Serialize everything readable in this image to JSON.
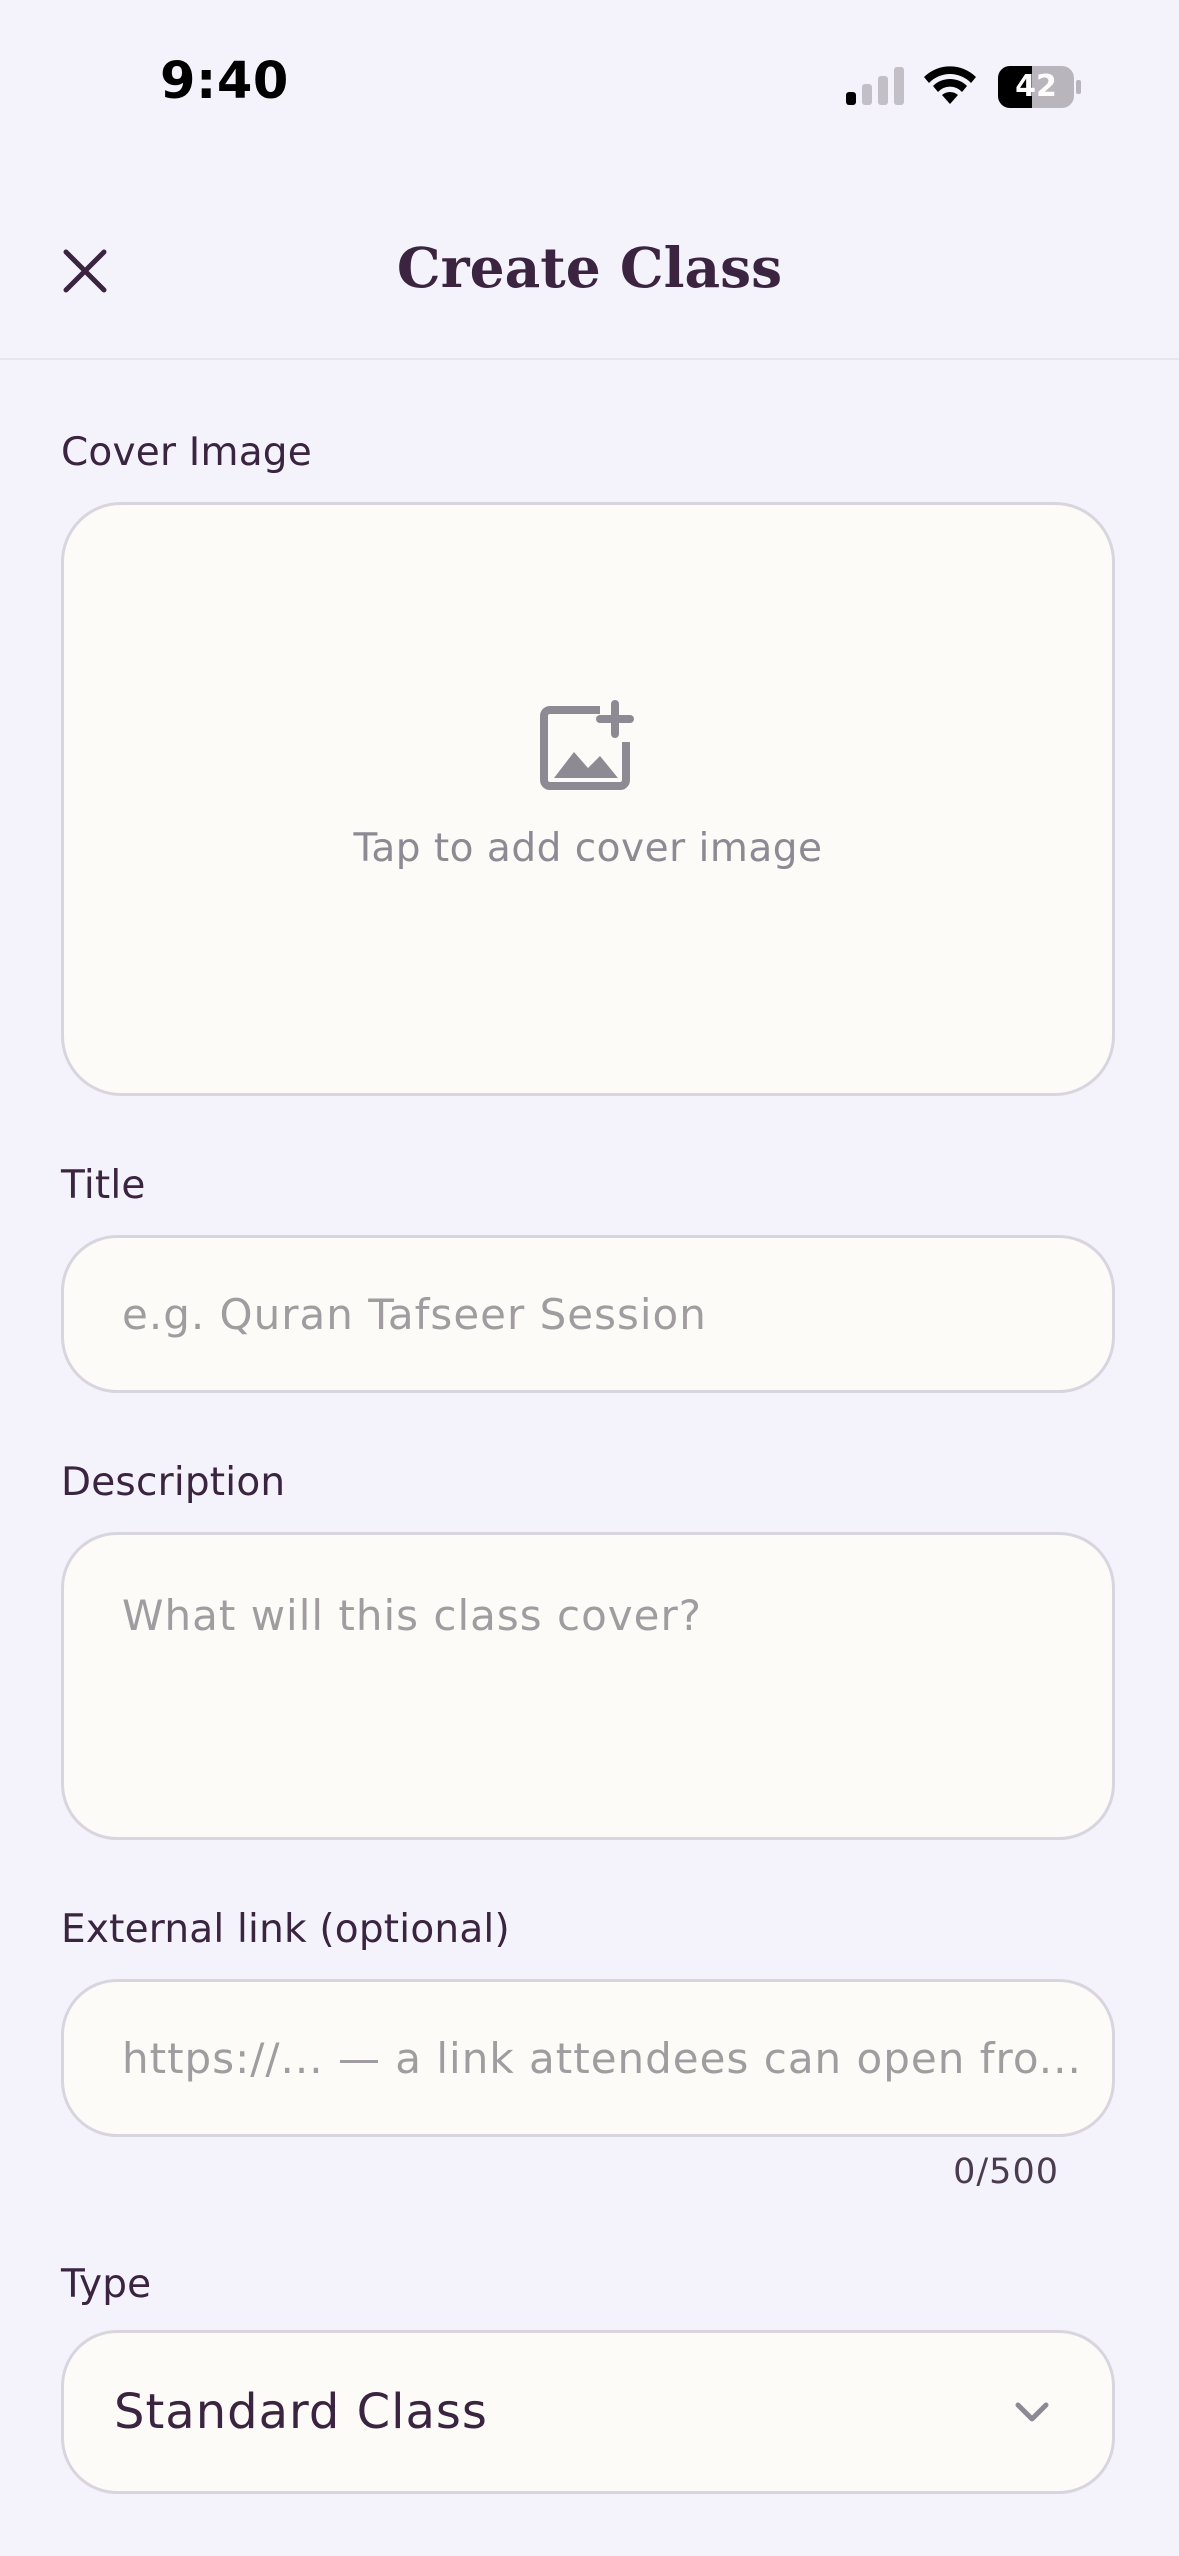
{
  "status_bar": {
    "time": "9:40",
    "battery": "42"
  },
  "header": {
    "title": "Create Class",
    "close_icon": "close-icon"
  },
  "cover_image": {
    "label": "Cover Image",
    "prompt": "Tap to add cover image",
    "icon": "add-image-icon"
  },
  "title_field": {
    "label": "Title",
    "placeholder": "e.g. Quran Tafseer Session",
    "value": ""
  },
  "description_field": {
    "label": "Description",
    "placeholder": "What will this class cover?",
    "value": ""
  },
  "external_link_field": {
    "label": "External link (optional)",
    "placeholder": "https://... — a link attendees can open fro...",
    "value": "",
    "counter": "0/500"
  },
  "type_field": {
    "label": "Type",
    "selected": "Standard Class",
    "icon": "chevron-down-icon"
  },
  "colors": {
    "background": "#F4F3FC",
    "field_background": "#FCFBF8",
    "field_border": "#D8D5DE",
    "primary_text": "#3A2440",
    "placeholder_text": "#A19C9F"
  }
}
